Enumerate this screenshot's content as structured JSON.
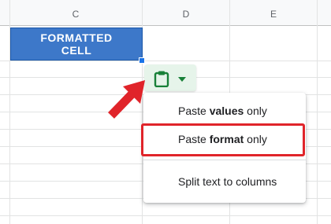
{
  "sheet": {
    "columns": [
      "C",
      "D",
      "E"
    ],
    "formatted_cell": {
      "text": "FORMATTED\nCELL",
      "fill_color": "#3d78c9"
    }
  },
  "paste_menu": {
    "button_color": "#e6f4ea",
    "items": [
      {
        "pre": "Paste ",
        "bold": "values",
        "post": " only"
      },
      {
        "pre": "Paste ",
        "bold": "format",
        "post": " only",
        "highlighted": true
      },
      {
        "pre": "Split text to columns",
        "bold": "",
        "post": ""
      }
    ]
  },
  "annotations": {
    "arrow_color": "#e0242a",
    "highlight_color": "#e0242a"
  }
}
